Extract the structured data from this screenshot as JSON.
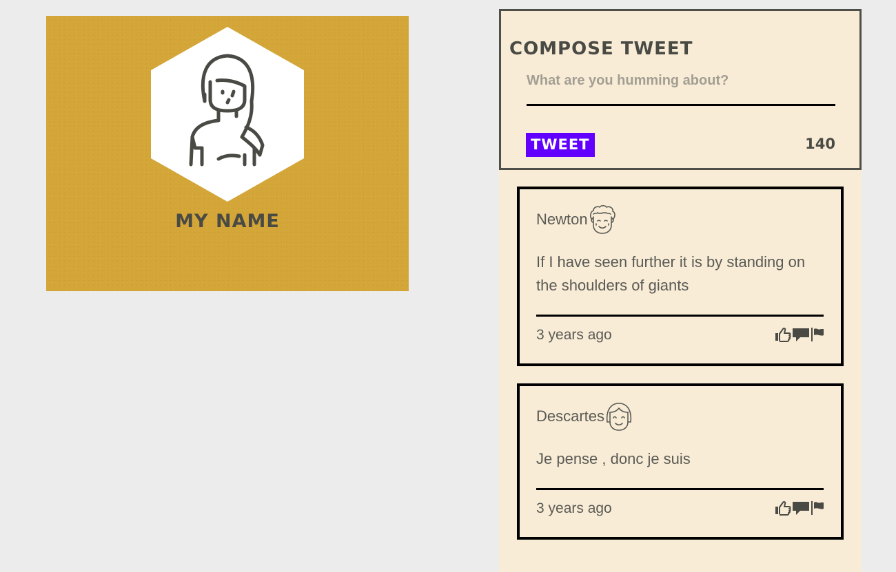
{
  "profile": {
    "name": "My Name",
    "avatar_icon": "woman-avatar-icon",
    "card_color": "#d4a537"
  },
  "compose": {
    "title": "Compose Tweet",
    "placeholder": "What are you humming about?",
    "button_label": "Tweet",
    "char_count": "140",
    "button_color": "#6200ff"
  },
  "tweets": [
    {
      "author": "Newton",
      "avatar_icon": "curly-hair-face-icon",
      "text": "If I have seen further it is by standing on the shoulders of giants",
      "time": "3 years ago",
      "actions": [
        "like-icon",
        "comment-icon",
        "flag-icon"
      ]
    },
    {
      "author": "Descartes",
      "avatar_icon": "bangs-hair-face-icon",
      "text": "Je pense , donc je suis",
      "time": "3 years ago",
      "actions": [
        "like-icon",
        "comment-icon",
        "flag-icon"
      ]
    }
  ]
}
